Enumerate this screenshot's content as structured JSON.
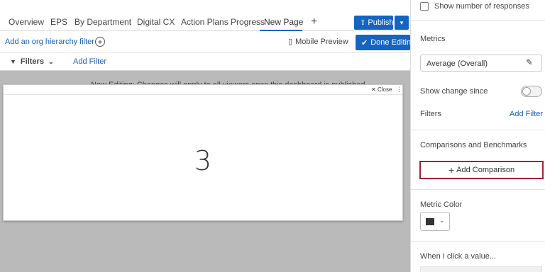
{
  "tabs": [
    {
      "label": "Overview"
    },
    {
      "label": "EPS"
    },
    {
      "label": "By Department"
    },
    {
      "label": "Digital CX"
    },
    {
      "label": "Action Plans Progress"
    },
    {
      "label": "New Page"
    }
  ],
  "active_tab": "New Page",
  "add_tab_symbol": "+",
  "toolbar": {
    "publish_label": "Publish",
    "done_label": "Done Editing"
  },
  "subbar": {
    "org_filter_label": "Add an org hierarchy filter",
    "mobile_preview_label": "Mobile Preview"
  },
  "filterbar": {
    "filters_label": "Filters",
    "add_filter_label": "Add Filter"
  },
  "notice": "Now Editing: Changes will apply to all viewers once this dashboard is published.",
  "widget": {
    "close_label": "Close",
    "value": "3"
  },
  "panel": {
    "show_responses_label": "Show number of responses",
    "metrics_heading": "Metrics",
    "metric_select_value": "Average (Overall)",
    "show_change_label": "Show change since",
    "show_change_on": false,
    "filters_label": "Filters",
    "add_filter_label": "Add Filter",
    "comparisons_heading": "Comparisons and Benchmarks",
    "add_comparison_label": "Add Comparison",
    "metric_color_heading": "Metric Color",
    "metric_color": "#333333",
    "click_value_heading": "When I click a value..."
  },
  "colors": {
    "accent": "#1565c0",
    "highlight_border": "#a32035",
    "link": "#1a5eb7"
  }
}
